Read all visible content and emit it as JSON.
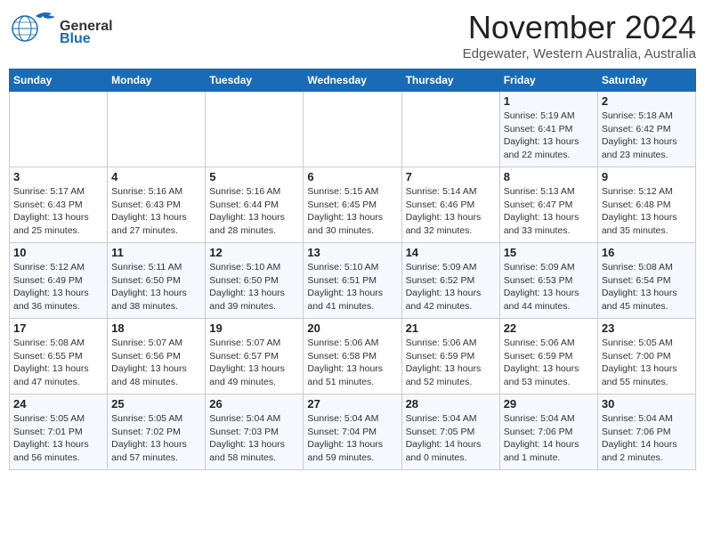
{
  "header": {
    "logo_general": "General",
    "logo_blue": "Blue",
    "title": "November 2024",
    "subtitle": "Edgewater, Western Australia, Australia"
  },
  "weekdays": [
    "Sunday",
    "Monday",
    "Tuesday",
    "Wednesday",
    "Thursday",
    "Friday",
    "Saturday"
  ],
  "weeks": [
    [
      {
        "day": "",
        "info": ""
      },
      {
        "day": "",
        "info": ""
      },
      {
        "day": "",
        "info": ""
      },
      {
        "day": "",
        "info": ""
      },
      {
        "day": "",
        "info": ""
      },
      {
        "day": "1",
        "info": "Sunrise: 5:19 AM\nSunset: 6:41 PM\nDaylight: 13 hours\nand 22 minutes."
      },
      {
        "day": "2",
        "info": "Sunrise: 5:18 AM\nSunset: 6:42 PM\nDaylight: 13 hours\nand 23 minutes."
      }
    ],
    [
      {
        "day": "3",
        "info": "Sunrise: 5:17 AM\nSunset: 6:43 PM\nDaylight: 13 hours\nand 25 minutes."
      },
      {
        "day": "4",
        "info": "Sunrise: 5:16 AM\nSunset: 6:43 PM\nDaylight: 13 hours\nand 27 minutes."
      },
      {
        "day": "5",
        "info": "Sunrise: 5:16 AM\nSunset: 6:44 PM\nDaylight: 13 hours\nand 28 minutes."
      },
      {
        "day": "6",
        "info": "Sunrise: 5:15 AM\nSunset: 6:45 PM\nDaylight: 13 hours\nand 30 minutes."
      },
      {
        "day": "7",
        "info": "Sunrise: 5:14 AM\nSunset: 6:46 PM\nDaylight: 13 hours\nand 32 minutes."
      },
      {
        "day": "8",
        "info": "Sunrise: 5:13 AM\nSunset: 6:47 PM\nDaylight: 13 hours\nand 33 minutes."
      },
      {
        "day": "9",
        "info": "Sunrise: 5:12 AM\nSunset: 6:48 PM\nDaylight: 13 hours\nand 35 minutes."
      }
    ],
    [
      {
        "day": "10",
        "info": "Sunrise: 5:12 AM\nSunset: 6:49 PM\nDaylight: 13 hours\nand 36 minutes."
      },
      {
        "day": "11",
        "info": "Sunrise: 5:11 AM\nSunset: 6:50 PM\nDaylight: 13 hours\nand 38 minutes."
      },
      {
        "day": "12",
        "info": "Sunrise: 5:10 AM\nSunset: 6:50 PM\nDaylight: 13 hours\nand 39 minutes."
      },
      {
        "day": "13",
        "info": "Sunrise: 5:10 AM\nSunset: 6:51 PM\nDaylight: 13 hours\nand 41 minutes."
      },
      {
        "day": "14",
        "info": "Sunrise: 5:09 AM\nSunset: 6:52 PM\nDaylight: 13 hours\nand 42 minutes."
      },
      {
        "day": "15",
        "info": "Sunrise: 5:09 AM\nSunset: 6:53 PM\nDaylight: 13 hours\nand 44 minutes."
      },
      {
        "day": "16",
        "info": "Sunrise: 5:08 AM\nSunset: 6:54 PM\nDaylight: 13 hours\nand 45 minutes."
      }
    ],
    [
      {
        "day": "17",
        "info": "Sunrise: 5:08 AM\nSunset: 6:55 PM\nDaylight: 13 hours\nand 47 minutes."
      },
      {
        "day": "18",
        "info": "Sunrise: 5:07 AM\nSunset: 6:56 PM\nDaylight: 13 hours\nand 48 minutes."
      },
      {
        "day": "19",
        "info": "Sunrise: 5:07 AM\nSunset: 6:57 PM\nDaylight: 13 hours\nand 49 minutes."
      },
      {
        "day": "20",
        "info": "Sunrise: 5:06 AM\nSunset: 6:58 PM\nDaylight: 13 hours\nand 51 minutes."
      },
      {
        "day": "21",
        "info": "Sunrise: 5:06 AM\nSunset: 6:59 PM\nDaylight: 13 hours\nand 52 minutes."
      },
      {
        "day": "22",
        "info": "Sunrise: 5:06 AM\nSunset: 6:59 PM\nDaylight: 13 hours\nand 53 minutes."
      },
      {
        "day": "23",
        "info": "Sunrise: 5:05 AM\nSunset: 7:00 PM\nDaylight: 13 hours\nand 55 minutes."
      }
    ],
    [
      {
        "day": "24",
        "info": "Sunrise: 5:05 AM\nSunset: 7:01 PM\nDaylight: 13 hours\nand 56 minutes."
      },
      {
        "day": "25",
        "info": "Sunrise: 5:05 AM\nSunset: 7:02 PM\nDaylight: 13 hours\nand 57 minutes."
      },
      {
        "day": "26",
        "info": "Sunrise: 5:04 AM\nSunset: 7:03 PM\nDaylight: 13 hours\nand 58 minutes."
      },
      {
        "day": "27",
        "info": "Sunrise: 5:04 AM\nSunset: 7:04 PM\nDaylight: 13 hours\nand 59 minutes."
      },
      {
        "day": "28",
        "info": "Sunrise: 5:04 AM\nSunset: 7:05 PM\nDaylight: 14 hours\nand 0 minutes."
      },
      {
        "day": "29",
        "info": "Sunrise: 5:04 AM\nSunset: 7:06 PM\nDaylight: 14 hours\nand 1 minute."
      },
      {
        "day": "30",
        "info": "Sunrise: 5:04 AM\nSunset: 7:06 PM\nDaylight: 14 hours\nand 2 minutes."
      }
    ]
  ]
}
